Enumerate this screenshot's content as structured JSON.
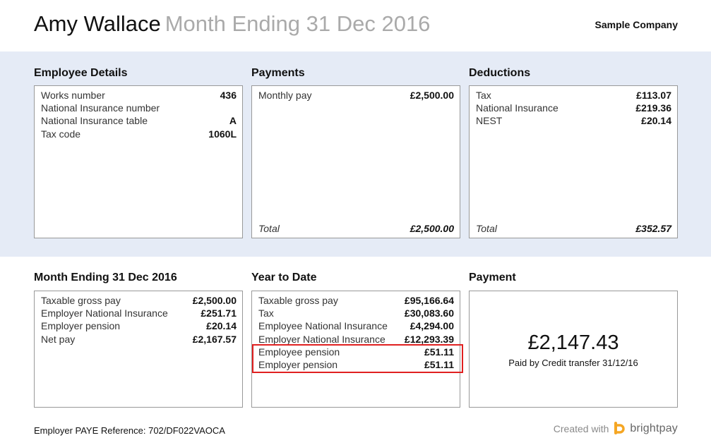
{
  "header": {
    "employee_name": "Amy Wallace",
    "period": "Month Ending 31 Dec 2016",
    "company": "Sample Company"
  },
  "employee_details": {
    "title": "Employee Details",
    "rows": [
      {
        "label": "Works number",
        "value": "436"
      },
      {
        "label": "National Insurance number",
        "value": ""
      },
      {
        "label": "National Insurance table",
        "value": "A"
      },
      {
        "label": "Tax code",
        "value": "1060L"
      }
    ]
  },
  "payments": {
    "title": "Payments",
    "rows": [
      {
        "label": "Monthly pay",
        "value": "£2,500.00"
      }
    ],
    "total_label": "Total",
    "total_value": "£2,500.00"
  },
  "deductions": {
    "title": "Deductions",
    "rows": [
      {
        "label": "Tax",
        "value": "£113.07"
      },
      {
        "label": "National Insurance",
        "value": "£219.36"
      },
      {
        "label": "NEST",
        "value": "£20.14"
      }
    ],
    "total_label": "Total",
    "total_value": "£352.57"
  },
  "month_ending": {
    "title": "Month Ending 31 Dec 2016",
    "rows": [
      {
        "label": "Taxable gross pay",
        "value": "£2,500.00"
      },
      {
        "label": "Employer National Insurance",
        "value": "£251.71"
      },
      {
        "label": "Employer pension",
        "value": "£20.14"
      },
      {
        "label": "Net pay",
        "value": "£2,167.57"
      }
    ]
  },
  "year_to_date": {
    "title": "Year to Date",
    "rows": [
      {
        "label": "Taxable gross pay",
        "value": "£95,166.64"
      },
      {
        "label": "Tax",
        "value": "£30,083.60"
      },
      {
        "label": "Employee National Insurance",
        "value": "£4,294.00"
      },
      {
        "label": "Employer National Insurance",
        "value": "£12,293.39"
      },
      {
        "label": "Employee pension",
        "value": "£51.11"
      },
      {
        "label": "Employer pension",
        "value": "£51.11"
      }
    ]
  },
  "payment": {
    "title": "Payment",
    "amount": "£2,147.43",
    "note": "Paid by Credit transfer 31/12/16"
  },
  "footer": {
    "employer_ref": "Employer PAYE Reference: 702/DF022VAOCA",
    "created_with": "Created with",
    "brand": "brightpay",
    "brand_color": "#f5a623"
  },
  "colors": {
    "band": "#e5ebf6",
    "highlight": "#e02020"
  }
}
